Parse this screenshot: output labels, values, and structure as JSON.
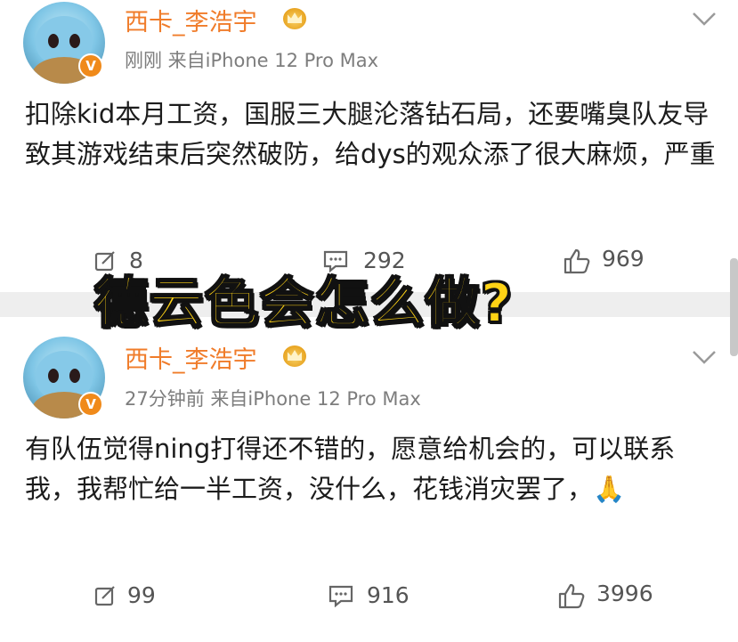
{
  "posts": [
    {
      "username": "西卡_李浩宇",
      "meta": "刚刚  来自iPhone 12 Pro Max",
      "text": "扣除kid本月工资，国服三大腿沦落钻石局，还要嘴臭队友导致其游戏结束后突然破防，给dys的观众添了很大麻烦，严重",
      "reposts": "8",
      "comments": "292",
      "likes": "969"
    },
    {
      "username": "西卡_李浩宇",
      "meta": "27分钟前  来自iPhone 12 Pro Max",
      "text": "有队伍觉得ning打得还不错的，愿意给机会的，可以联系我，我帮忙给一半工资，没什么，花钱消灾罢了，🙏",
      "reposts": "99",
      "comments": "916",
      "likes": "3996"
    }
  ],
  "overlay_caption": "德云色会怎么做?",
  "colors": {
    "username": "#f07c2a",
    "overlay_fill": "#ffd315",
    "overlay_stroke": "#111111"
  },
  "icons": [
    "avatar-squirtle",
    "verified-badge-icon",
    "crown-icon",
    "chevron-down-icon",
    "repost-icon",
    "comment-icon",
    "like-icon"
  ]
}
